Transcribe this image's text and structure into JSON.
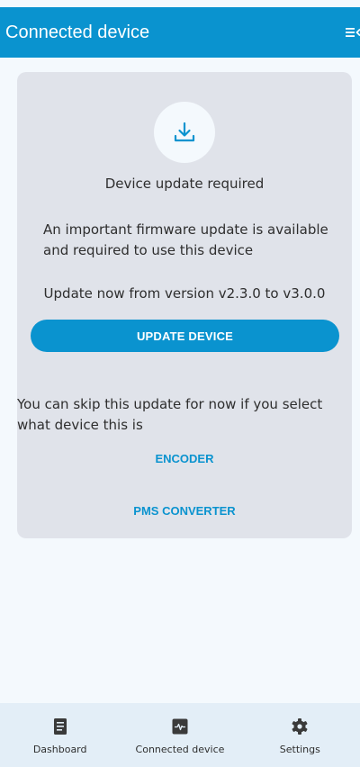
{
  "app_bar": {
    "title": "Connected device",
    "menu_icon": "menu-collapse-icon"
  },
  "update_card": {
    "icon": "download-icon",
    "title": "Device update required",
    "description": "An important firmware update is available and required to use this device",
    "version_text": "Update now from version v2.3.0 to v3.0.0",
    "update_button_label": "UPDATE DEVICE",
    "skip_text": "You can skip this update for now if you select what device this is",
    "device_options": [
      "ENCODER",
      "PMS CONVERTER"
    ]
  },
  "bottom_nav": {
    "items": [
      {
        "label": "Dashboard",
        "icon": "document-icon"
      },
      {
        "label": "Connected device",
        "icon": "pulse-monitor-icon"
      },
      {
        "label": "Settings",
        "icon": "gear-icon"
      }
    ]
  },
  "colors": {
    "primary": "#0a93cf",
    "card_background": "#e0e3ea",
    "page_background": "#f4f9fd",
    "nav_background": "#e3eef7"
  }
}
